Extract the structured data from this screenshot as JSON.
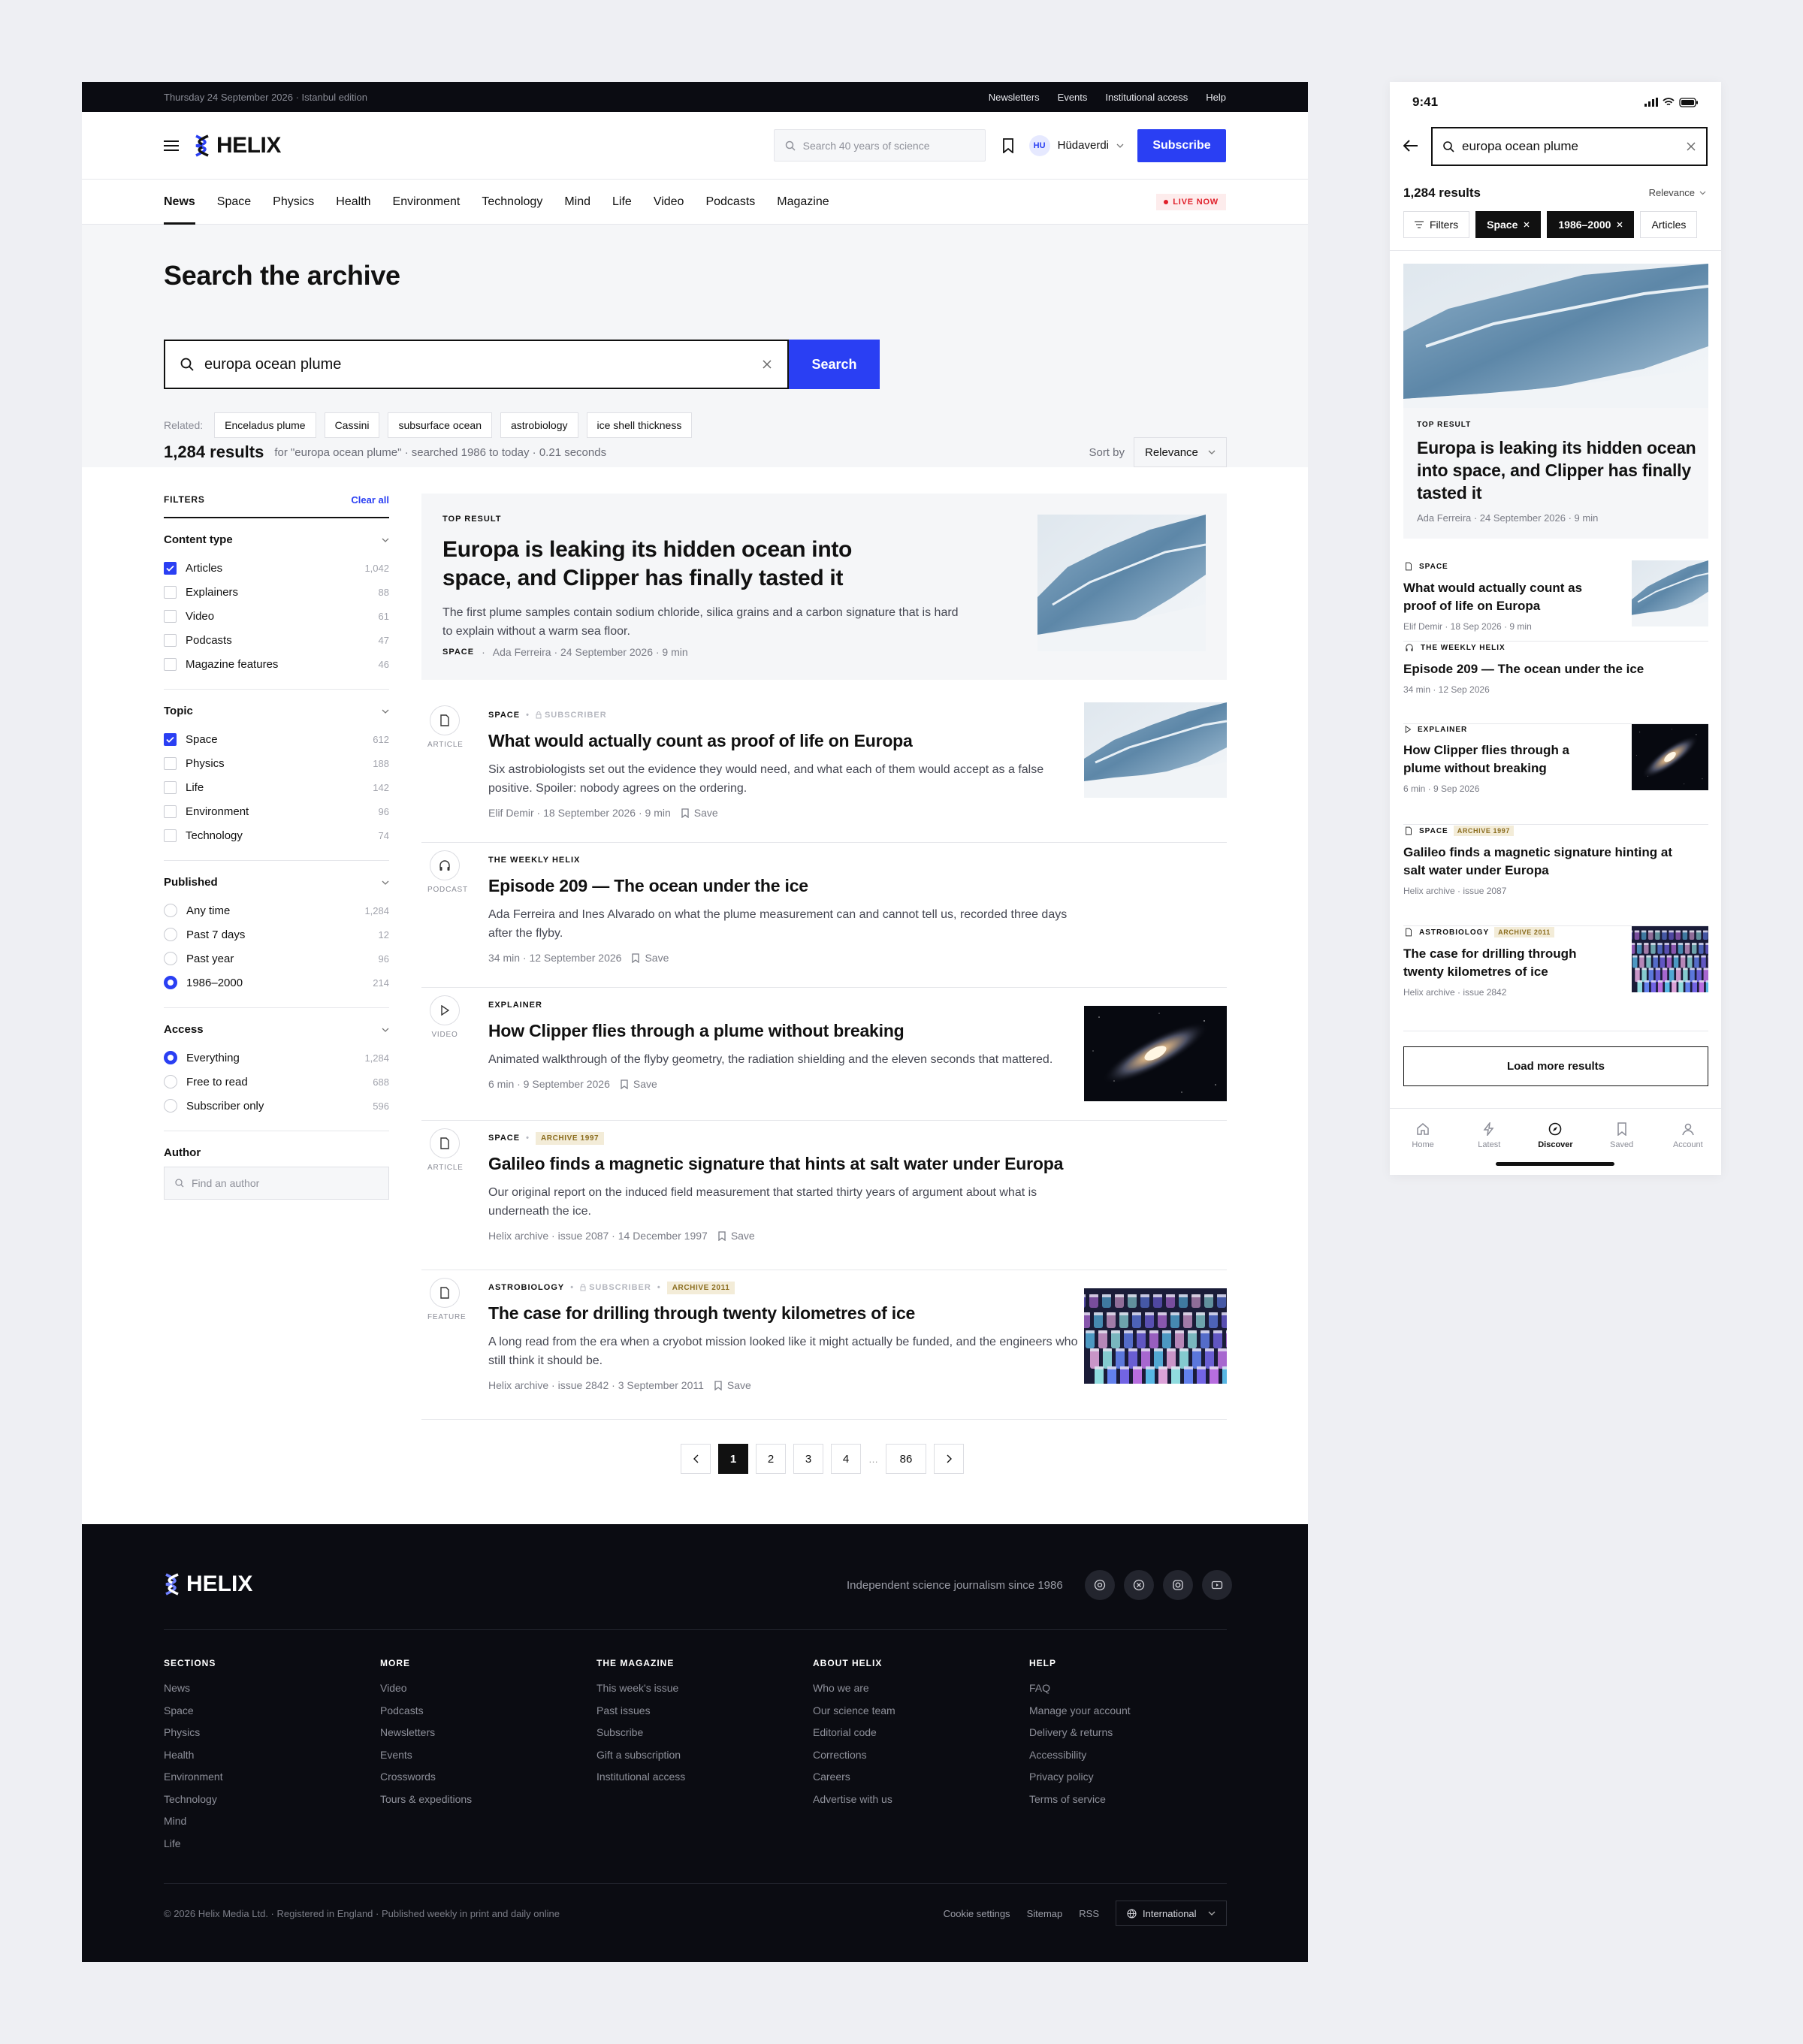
{
  "desktop": {
    "topbar": {
      "date": "Thursday 24 September 2026 · Istanbul edition",
      "links": [
        "Newsletters",
        "Events",
        "Institutional access",
        "Help"
      ]
    },
    "header": {
      "logo": "HELIX",
      "search_placeholder": "Search 40 years of science",
      "user_initials": "HU",
      "user_name": "Hüdaverdi",
      "subscribe": "Subscribe"
    },
    "nav": {
      "items": [
        "News",
        "Space",
        "Physics",
        "Health",
        "Environment",
        "Technology",
        "Mind",
        "Life",
        "Video",
        "Podcasts",
        "Magazine"
      ],
      "live": "LIVE NOW"
    },
    "hero": {
      "title": "Search the archive",
      "query": "europa ocean plume",
      "search_button": "Search",
      "related_label": "Related:",
      "related": [
        "Enceladus plume",
        "Cassini",
        "subsurface ocean",
        "astrobiology",
        "ice shell thickness"
      ]
    },
    "results_bar": {
      "count": "1,284 results",
      "for_text": "for \"europa ocean plume\" · searched 1986 to today · 0.21 seconds",
      "sort_label": "Sort by",
      "sort_value": "Relevance"
    },
    "filters": {
      "title": "FILTERS",
      "clear": "Clear all",
      "content_type": {
        "title": "Content type",
        "items": [
          {
            "label": "Articles",
            "count": "1,042",
            "checked": true
          },
          {
            "label": "Explainers",
            "count": "88",
            "checked": false
          },
          {
            "label": "Video",
            "count": "61",
            "checked": false
          },
          {
            "label": "Podcasts",
            "count": "47",
            "checked": false
          },
          {
            "label": "Magazine features",
            "count": "46",
            "checked": false
          }
        ]
      },
      "topic": {
        "title": "Topic",
        "items": [
          {
            "label": "Space",
            "count": "612",
            "checked": true
          },
          {
            "label": "Physics",
            "count": "188",
            "checked": false
          },
          {
            "label": "Life",
            "count": "142",
            "checked": false
          },
          {
            "label": "Environment",
            "count": "96",
            "checked": false
          },
          {
            "label": "Technology",
            "count": "74",
            "checked": false
          }
        ]
      },
      "published": {
        "title": "Published",
        "items": [
          {
            "label": "Any time",
            "count": "1,284",
            "checked": false
          },
          {
            "label": "Past 7 days",
            "count": "12",
            "checked": false
          },
          {
            "label": "Past year",
            "count": "96",
            "checked": false
          },
          {
            "label": "1986–2000",
            "count": "214",
            "checked": true
          }
        ]
      },
      "access": {
        "title": "Access",
        "items": [
          {
            "label": "Everything",
            "count": "1,284",
            "checked": true
          },
          {
            "label": "Free to read",
            "count": "688",
            "checked": false
          },
          {
            "label": "Subscriber only",
            "count": "596",
            "checked": false
          }
        ]
      },
      "author": {
        "title": "Author",
        "placeholder": "Find an author"
      }
    },
    "top_result": {
      "kicker": "TOP RESULT",
      "title": "Europa is leaking its hidden ocean into space, and Clipper has finally tasted it",
      "desc": "The first plume samples contain sodium chloride, silica grains and a carbon signature that is hard to explain without a warm sea floor.",
      "section": "SPACE",
      "meta": "Ada Ferreira · 24 September 2026 · 9 min"
    },
    "results": [
      {
        "type": "ARTICLE",
        "kicker": "SPACE",
        "subscriber": "SUBSCRIBER",
        "title": "What would actually count as proof of life on Europa",
        "desc": "Six astrobiologists set out the evidence they would need, and what each of them would accept as a false positive. Spoiler: nobody agrees on the ordering.",
        "meta": "Elif Demir · 18 September 2026 · 9 min",
        "save": "Save"
      },
      {
        "type": "PODCAST",
        "kicker": "THE WEEKLY HELIX",
        "title": "Episode 209 — The ocean under the ice",
        "desc": "Ada Ferreira and Ines Alvarado on what the plume measurement can and cannot tell us, recorded three days after the flyby.",
        "meta": "34 min · 12 September 2026",
        "save": "Save"
      },
      {
        "type": "VIDEO",
        "kicker": "EXPLAINER",
        "title": "How Clipper flies through a plume without breaking",
        "desc": "Animated walkthrough of the flyby geometry, the radiation shielding and the eleven seconds that mattered.",
        "meta": "6 min · 9 September 2026",
        "save": "Save"
      },
      {
        "type": "ARTICLE",
        "kicker": "SPACE",
        "archive": "ARCHIVE 1997",
        "title": "Galileo finds a magnetic signature that hints at salt water under Europa",
        "desc": "Our original report on the induced field measurement that started thirty years of argument about what is underneath the ice.",
        "meta": "Helix archive · issue 2087 · 14 December 1997",
        "save": "Save"
      },
      {
        "type": "FEATURE",
        "kicker": "ASTROBIOLOGY",
        "subscriber": "SUBSCRIBER",
        "archive": "ARCHIVE 2011",
        "title": "The case for drilling through twenty kilometres of ice",
        "desc": "A long read from the era when a cryobot mission looked like it might actually be funded, and the engineers who still think it should be.",
        "meta": "Helix archive · issue 2842 · 3 September 2011",
        "save": "Save"
      }
    ],
    "pagination": [
      "1",
      "2",
      "3",
      "4",
      "…",
      "86"
    ],
    "footer": {
      "logo": "HELIX",
      "tagline": "Independent science journalism since 1986",
      "cols": [
        {
          "h": "SECTIONS",
          "links": [
            "News",
            "Space",
            "Physics",
            "Health",
            "Environment",
            "Technology",
            "Mind",
            "Life"
          ]
        },
        {
          "h": "MORE",
          "links": [
            "Video",
            "Podcasts",
            "Newsletters",
            "Events",
            "Crosswords",
            "Tours & expeditions"
          ]
        },
        {
          "h": "THE MAGAZINE",
          "links": [
            "This week's issue",
            "Past issues",
            "Subscribe",
            "Gift a subscription",
            "Institutional access"
          ]
        },
        {
          "h": "ABOUT HELIX",
          "links": [
            "Who we are",
            "Our science team",
            "Editorial code",
            "Corrections",
            "Careers",
            "Advertise with us"
          ]
        },
        {
          "h": "HELP",
          "links": [
            "FAQ",
            "Manage your account",
            "Delivery & returns",
            "Accessibility",
            "Privacy policy",
            "Terms of service"
          ]
        }
      ],
      "copyright": "© 2026 Helix Media Ltd. · Registered in England · Published weekly in print and daily online",
      "bottom_links": [
        "Cookie settings",
        "Sitemap",
        "RSS"
      ],
      "region": "International"
    }
  },
  "mobile": {
    "time": "9:41",
    "query": "europa ocean plume",
    "count": "1,284 results",
    "sort": "Relevance",
    "chips": [
      "Filters",
      "Space",
      "1986–2000",
      "Articles"
    ],
    "top": {
      "kicker": "TOP RESULT",
      "title": "Europa is leaking its hidden ocean into space, and Clipper has finally tasted it",
      "meta": "Ada Ferreira · 24 September 2026 · 9 min"
    },
    "items": [
      {
        "kicker": "SPACE",
        "title": "What would actually count as proof of life on Europa",
        "meta": "Elif Demir · 18 Sep 2026 · 9 min"
      },
      {
        "kicker": "THE WEEKLY HELIX",
        "title": "Episode 209 — The ocean under the ice",
        "meta": "34 min · 12 Sep 2026"
      },
      {
        "kicker": "EXPLAINER",
        "title": "How Clipper flies through a plume without breaking",
        "meta": "6 min · 9 Sep 2026"
      },
      {
        "kicker": "SPACE",
        "archive": "ARCHIVE 1997",
        "title": "Galileo finds a magnetic signature hinting at salt water under Europa",
        "meta": "Helix archive · issue 2087"
      },
      {
        "kicker": "ASTROBIOLOGY",
        "archive": "ARCHIVE 2011",
        "title": "The case for drilling through twenty kilometres of ice",
        "meta": "Helix archive · issue 2842"
      }
    ],
    "load_more": "Load more results",
    "tabs": [
      "Home",
      "Latest",
      "Discover",
      "Saved",
      "Account"
    ]
  }
}
